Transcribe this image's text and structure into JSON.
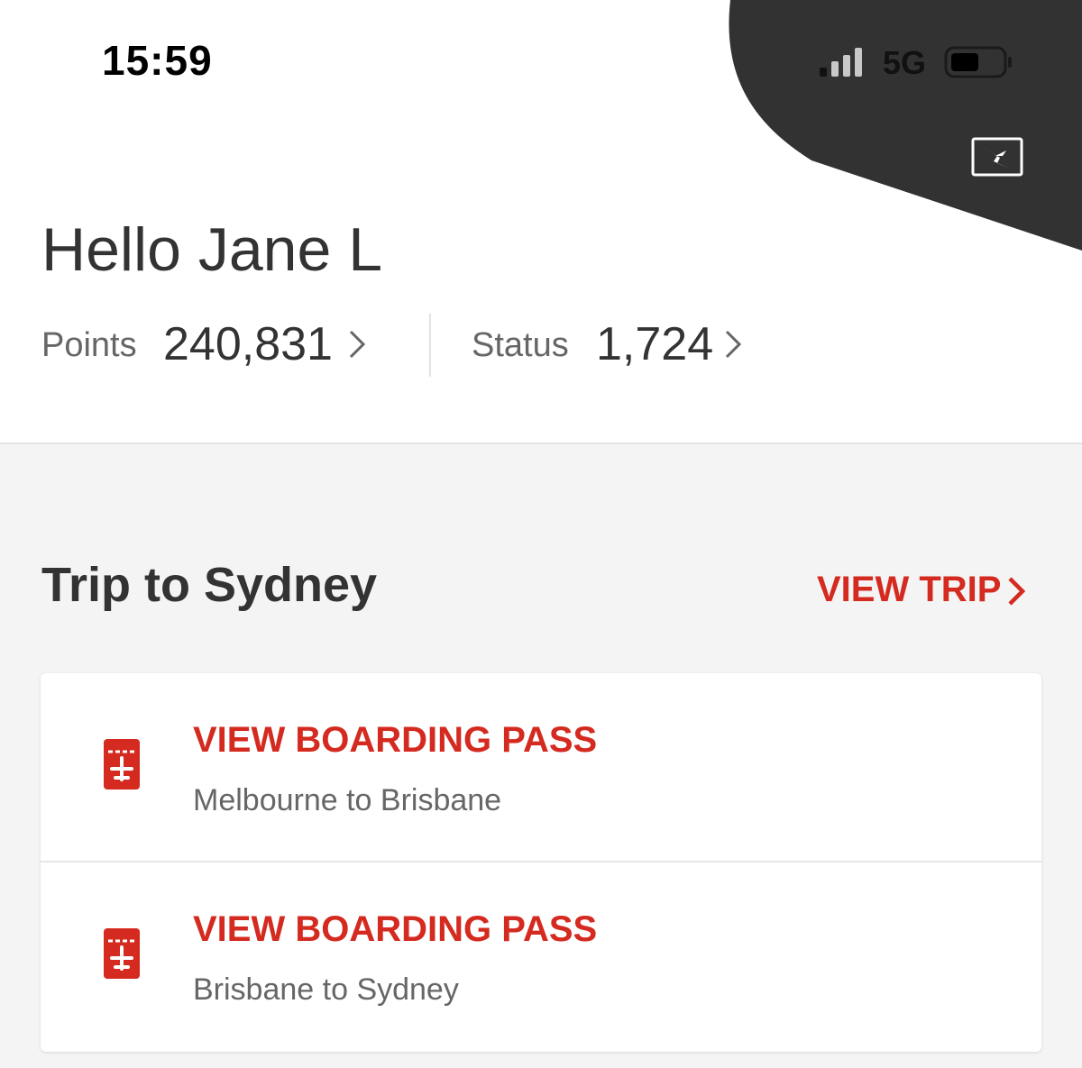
{
  "status_bar": {
    "time": "15:59",
    "network": "5G",
    "icons": [
      "signal-icon",
      "battery-icon"
    ]
  },
  "header": {
    "logo_icon": "qantas-kangaroo-icon",
    "greeting": "Hello Jane L",
    "points_label": "Points",
    "points_value": "240,831",
    "status_label": "Status",
    "status_value": "1,724"
  },
  "trip": {
    "title": "Trip to Sydney",
    "view_trip_label": "VIEW TRIP",
    "boarding_passes": [
      {
        "action_label": "VIEW BOARDING PASS",
        "route": "Melbourne to Brisbane"
      },
      {
        "action_label": "VIEW BOARDING PASS",
        "route": "Brisbane to Sydney"
      }
    ]
  },
  "colors": {
    "accent_red": "#d42a1f",
    "header_dark": "#323232",
    "background": "#f4f4f4"
  }
}
